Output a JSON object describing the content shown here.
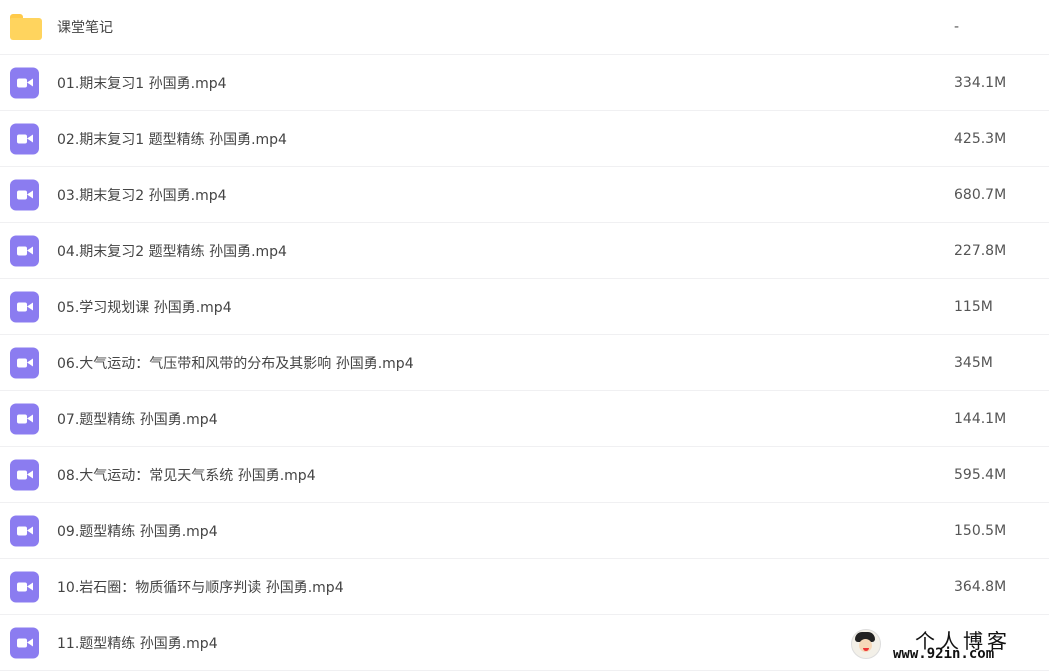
{
  "files": [
    {
      "name": "课堂笔记",
      "size": "-",
      "type": "folder"
    },
    {
      "name": "01.期末复习1 孙国勇.mp4",
      "size": "334.1M",
      "type": "video"
    },
    {
      "name": "02.期末复习1 题型精练 孙国勇.mp4",
      "size": "425.3M",
      "type": "video"
    },
    {
      "name": "03.期末复习2 孙国勇.mp4",
      "size": "680.7M",
      "type": "video"
    },
    {
      "name": "04.期末复习2 题型精练 孙国勇.mp4",
      "size": "227.8M",
      "type": "video"
    },
    {
      "name": "05.学习规划课 孙国勇.mp4",
      "size": "115M",
      "type": "video"
    },
    {
      "name": "06.大气运动：气压带和风带的分布及其影响 孙国勇.mp4",
      "size": "345M",
      "type": "video"
    },
    {
      "name": "07.题型精练 孙国勇.mp4",
      "size": "144.1M",
      "type": "video"
    },
    {
      "name": "08.大气运动：常见天气系统 孙国勇.mp4",
      "size": "595.4M",
      "type": "video"
    },
    {
      "name": "09.题型精练 孙国勇.mp4",
      "size": "150.5M",
      "type": "video"
    },
    {
      "name": "10.岩石圈：物质循环与顺序判读 孙国勇.mp4",
      "size": "364.8M",
      "type": "video"
    },
    {
      "name": "11.题型精练 孙国勇.mp4",
      "size": "",
      "type": "video"
    }
  ],
  "watermark": {
    "title": "个人博客",
    "url": "www.92in.com"
  },
  "colors": {
    "video_icon": "#8b7cf0",
    "folder_icon": "#ffd45e",
    "row_divider": "#f0f0f2"
  }
}
